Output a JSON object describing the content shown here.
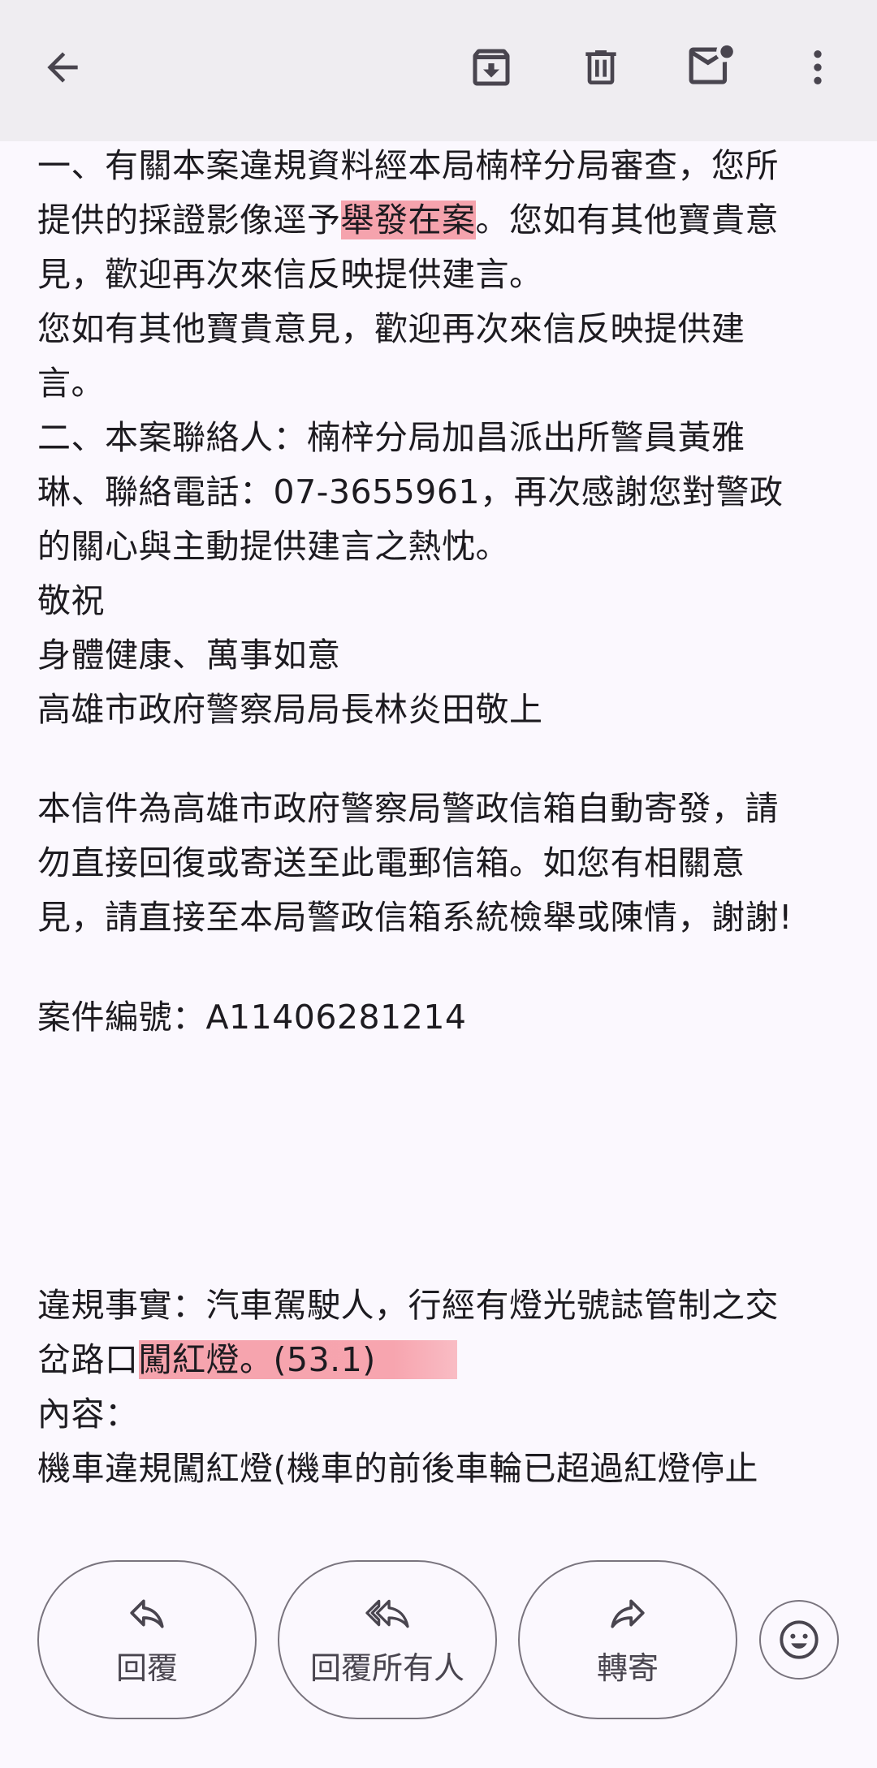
{
  "toolbar": {
    "back_icon": "arrow-back-icon",
    "archive_icon": "archive-icon",
    "delete_icon": "delete-icon",
    "mark_unread_icon": "mail-unread-icon",
    "more_icon": "more-vert-icon"
  },
  "email": {
    "lines": [
      "一、有關本案違規資料經本局楠梓分局審查，您所",
      "提供的採證影像逕予",
      "舉發在案",
      "。您如有其他寶貴意",
      "見，歡迎再次來信反映提供建言。",
      "您如有其他寶貴意見，歡迎再次來信反映提供建",
      "言。",
      "二、本案聯絡人：楠梓分局加昌派出所警員黃雅",
      "琳、聯絡電話：07-3655961，再次感謝您對警政",
      "的關心與主動提供建言之熱忱。",
      "敬祝",
      "身體健康、萬事如意",
      "高雄市政府警察局局長林炎田敬上"
    ],
    "notice_lines": [
      "本信件為高雄市政府警察局警政信箱自動寄發，請",
      "勿直接回復或寄送至此電郵信箱。如您有相關意",
      "見，請直接至本局警政信箱系統檢舉或陳情，謝謝!"
    ],
    "case_number": "案件編號：A11406281214",
    "violation_lines": [
      "違規事實：汽車駕駛人，行經有燈光號誌管制之交",
      "岔路口",
      "闖紅燈。(53.1)",
      "內容：",
      "機車違規闖紅燈(機車的前後車輪已超過紅燈停止"
    ]
  },
  "actions": {
    "reply_label": "回覆",
    "reply_all_label": "回覆所有人",
    "forward_label": "轉寄",
    "emoji_icon": "emoji-smile-icon"
  },
  "colors": {
    "highlight": "#f5a3ad",
    "toolbar_bg": "#efedf1",
    "page_bg": "#fbf8fe"
  }
}
